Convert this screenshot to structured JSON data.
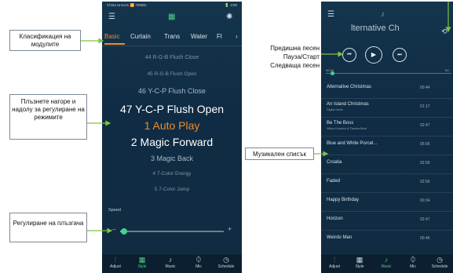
{
  "phone1": {
    "status_left": "China Unicom 📶 700B/s",
    "status_right": "🔋 3:00",
    "tabs": [
      "Basic",
      "Curtain",
      "Trans",
      "Water",
      "Fl"
    ],
    "modes": [
      {
        "text": "44 R-G-B Flush Close",
        "state": "far"
      },
      {
        "text": "45 R-G-B Flush Open",
        "state": "far"
      },
      {
        "text": "46 Y-C-P Flush Close",
        "state": "near"
      },
      {
        "text": "47 Y-C-P Flush Open",
        "state": "adjacent"
      },
      {
        "text": "1 Auto Play",
        "state": "selected"
      },
      {
        "text": "2 Magic Forward",
        "state": "adjacent"
      },
      {
        "text": "3 Magic Back",
        "state": "near"
      },
      {
        "text": "4 7-Color Energy",
        "state": "far"
      },
      {
        "text": "5 7-Color Jump",
        "state": "far"
      }
    ],
    "speed_label": "Speed",
    "slider_value": 0.04,
    "nav": [
      {
        "label": "Adjust",
        "icon": "adjust-icon"
      },
      {
        "label": "Style",
        "icon": "grid-icon"
      },
      {
        "label": "Music",
        "icon": "music-icon"
      },
      {
        "label": "Mic",
        "icon": "mic-icon"
      },
      {
        "label": "Schedule",
        "icon": "clock-icon"
      }
    ],
    "active_nav": 1
  },
  "phone2": {
    "title": "lternative Ch",
    "time_start": "00:00",
    "time_end": "00:",
    "progress": 0.05,
    "songs": [
      {
        "title": "Alternative Christmas",
        "sub": "",
        "dur": "00:44"
      },
      {
        "title": "An Island Christmas",
        "sub": "Digital Jams",
        "dur": "01:17"
      },
      {
        "title": "Be The Boss",
        "sub": "Wilow Knoxton & Tanuka Beat",
        "dur": "02:47"
      },
      {
        "title": "Blue and White Porcel...",
        "sub": "",
        "dur": "05:06"
      },
      {
        "title": "Croatia",
        "sub": "",
        "dur": "02:59"
      },
      {
        "title": "Faded",
        "sub": "",
        "dur": "02:56"
      },
      {
        "title": "Happy Birthday",
        "sub": "",
        "dur": "00:34"
      },
      {
        "title": "Horizon",
        "sub": "",
        "dur": "02:47"
      },
      {
        "title": "Weirdo Man",
        "sub": "",
        "dur": "00:46"
      }
    ],
    "nav": [
      {
        "label": "Adjust",
        "icon": "adjust-icon"
      },
      {
        "label": "Style",
        "icon": "grid-icon"
      },
      {
        "label": "Music",
        "icon": "music-icon"
      },
      {
        "label": "Mic",
        "icon": "mic-icon"
      },
      {
        "label": "Schedule",
        "icon": "clock-icon"
      }
    ],
    "active_nav": 2
  },
  "annotations": {
    "modules": "Класификация на модулите",
    "swipe": "Плъзнете нагоре и надолу за регулиране на режимите",
    "slider": "Регулиране на плъзгача",
    "prev": "Предишна песен",
    "pause": "Пауза/Старт",
    "next": "Следваща песен",
    "playlist": "Музикален списък"
  },
  "colors": {
    "accent_green": "#47d18c",
    "accent_orange": "#f28a2b",
    "annotation_arrow": "#7cc243",
    "background": "#0f2c44"
  }
}
